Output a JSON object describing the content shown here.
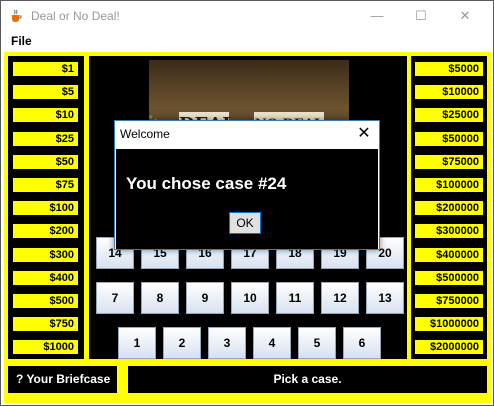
{
  "window": {
    "title": "Deal or No Deal!",
    "minimize": "—",
    "maximize": "☐",
    "close": "✕"
  },
  "menu": {
    "file": "File"
  },
  "left_values": [
    "$1",
    "$5",
    "$10",
    "$25",
    "$50",
    "$75",
    "$100",
    "$200",
    "$300",
    "$400",
    "$500",
    "$750",
    "$1000"
  ],
  "right_values": [
    "$5000",
    "$10000",
    "$25000",
    "$50000",
    "$75000",
    "$100000",
    "$200000",
    "$300000",
    "$400000",
    "$500000",
    "$750000",
    "$1000000",
    "$2000000"
  ],
  "logo": {
    "word1": "DEAL",
    "word2": "NO DEAL"
  },
  "cases": {
    "row1": [
      "14",
      "15",
      "16",
      "17",
      "18",
      "19",
      "20"
    ],
    "row2": [
      "7",
      "8",
      "9",
      "10",
      "11",
      "12",
      "13"
    ],
    "row3": [
      "1",
      "2",
      "3",
      "4",
      "5",
      "6"
    ]
  },
  "footer": {
    "briefcase": "? Your Briefcase",
    "status": "Pick a case."
  },
  "dialog": {
    "title": "Welcome",
    "message": "You chose case #24",
    "ok": "OK",
    "close": "✕"
  },
  "colors": {
    "board": "#ffff00",
    "panel": "#000000",
    "dialog_border": "#3c7fb1"
  }
}
